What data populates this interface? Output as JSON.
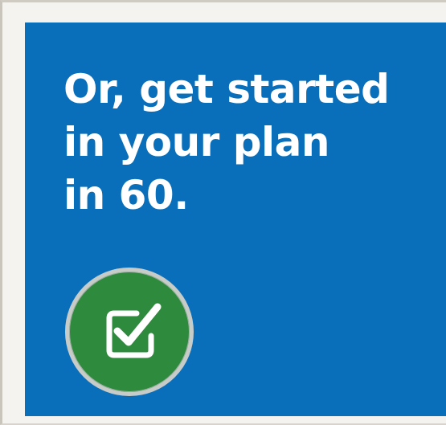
{
  "headline": {
    "line1": "Or, get started",
    "line2": "in your plan",
    "line3": "in 60."
  },
  "badge": {
    "icon": "checkbox-check-icon",
    "background_color": "#2e8a3c",
    "ring_color": "#c7ccc8"
  },
  "card": {
    "background_color": "#0a6fba"
  }
}
